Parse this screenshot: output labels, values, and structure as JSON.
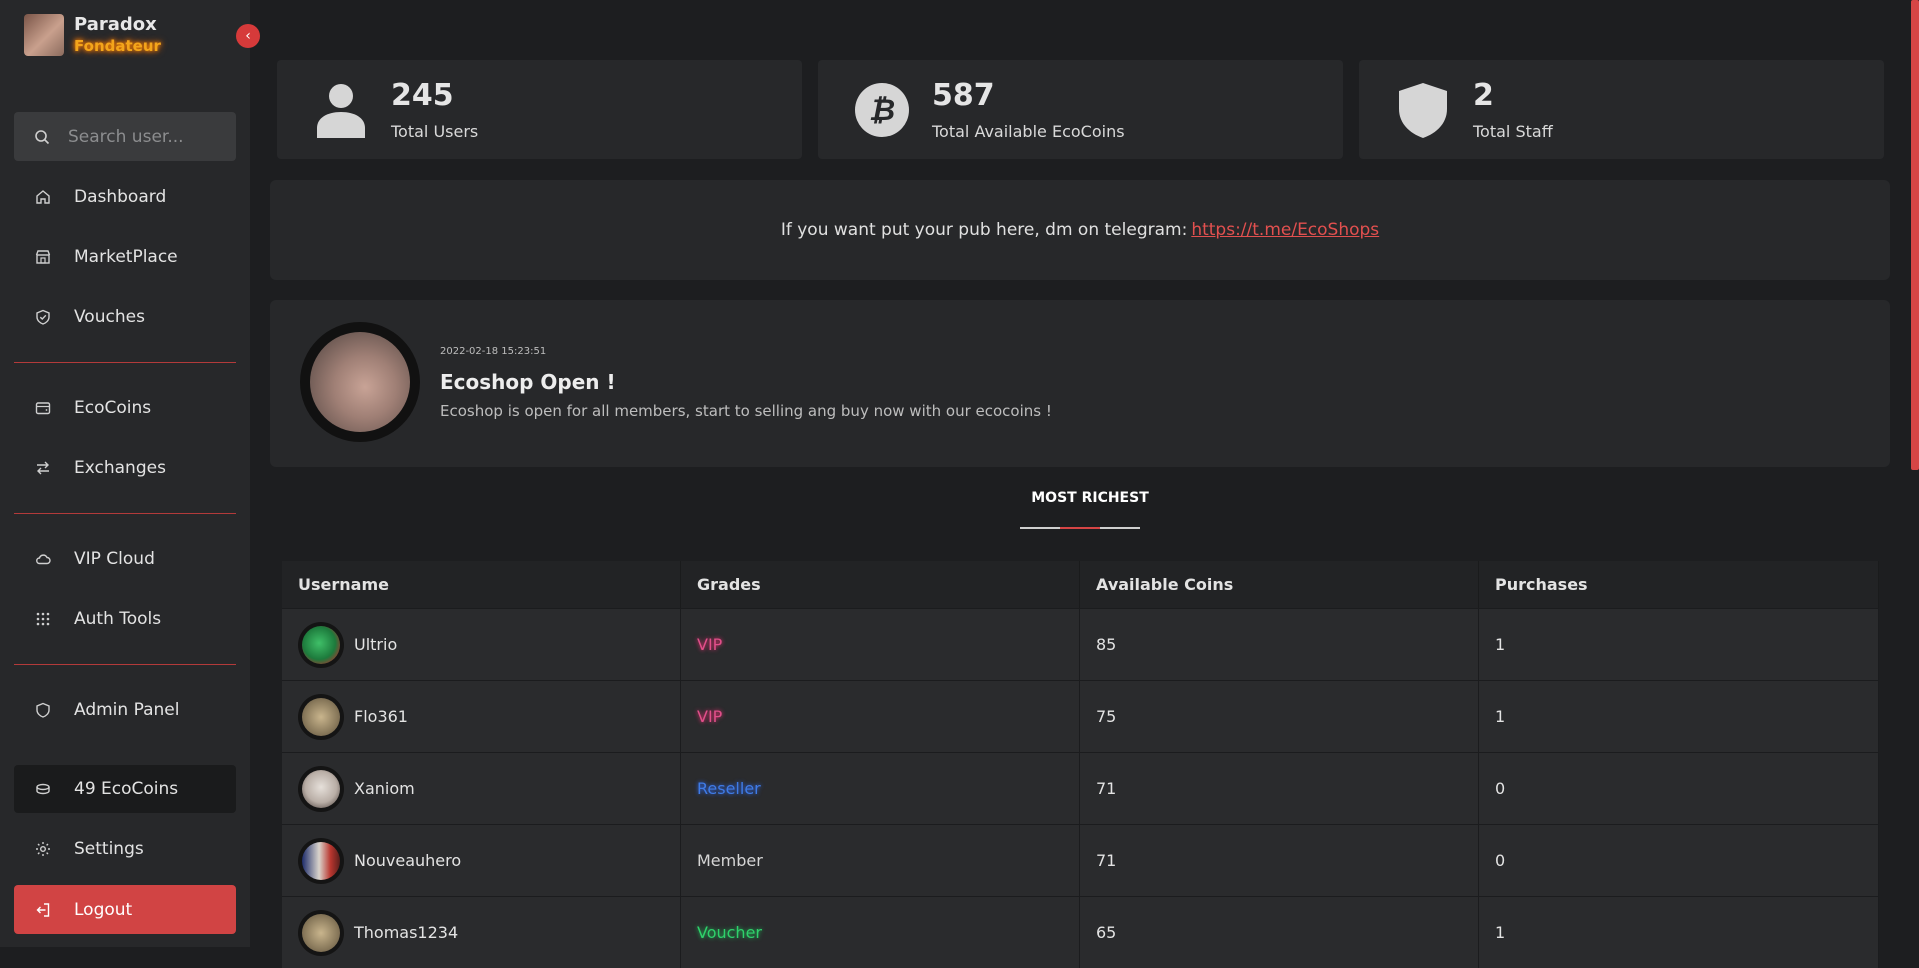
{
  "profile": {
    "name": "Paradox",
    "role": "Fondateur"
  },
  "search": {
    "placeholder": "Search user..."
  },
  "nav": {
    "dashboard": "Dashboard",
    "marketplace": "MarketPlace",
    "vouches": "Vouches",
    "ecocoins": "EcoCoins",
    "exchanges": "Exchanges",
    "vip_cloud": "VIP Cloud",
    "auth_tools": "Auth Tools",
    "admin_panel": "Admin Panel",
    "balance": "49 EcoCoins",
    "settings": "Settings",
    "logout": "Logout"
  },
  "stats": [
    {
      "value": "245",
      "label": "Total Users",
      "icon": "user-icon"
    },
    {
      "value": "587",
      "label": "Total Available EcoCoins",
      "icon": "bitcoin-icon"
    },
    {
      "value": "2",
      "label": "Total Staff",
      "icon": "shield-icon"
    }
  ],
  "pub": {
    "text": "If you want put your pub here, dm on telegram:",
    "link": "https://t.me/EcoShops"
  },
  "news": {
    "date": "2022-02-18 15:23:51",
    "title": "Ecoshop Open !",
    "description": "Ecoshop is open for all members, start to selling ang buy now with our ecocoins !"
  },
  "section_title": "MOST RICHEST",
  "table": {
    "headers": [
      "Username",
      "Grades",
      "Available Coins",
      "Purchases"
    ],
    "rows": [
      {
        "username": "Ultrio",
        "grade": "VIP",
        "coins": "85",
        "purchases": "1"
      },
      {
        "username": "Flo361",
        "grade": "VIP",
        "coins": "75",
        "purchases": "1"
      },
      {
        "username": "Xaniom",
        "grade": "Reseller",
        "coins": "71",
        "purchases": "0"
      },
      {
        "username": "Nouveauhero",
        "grade": "Member",
        "coins": "71",
        "purchases": "0"
      },
      {
        "username": "Thomas1234",
        "grade": "Voucher",
        "coins": "65",
        "purchases": "1"
      }
    ]
  },
  "colors": {
    "accent": "#d64545",
    "vip": "#e04f8a",
    "reseller": "#3f7be6",
    "voucher": "#2fd16b",
    "fondateur": "#f3a51b"
  }
}
